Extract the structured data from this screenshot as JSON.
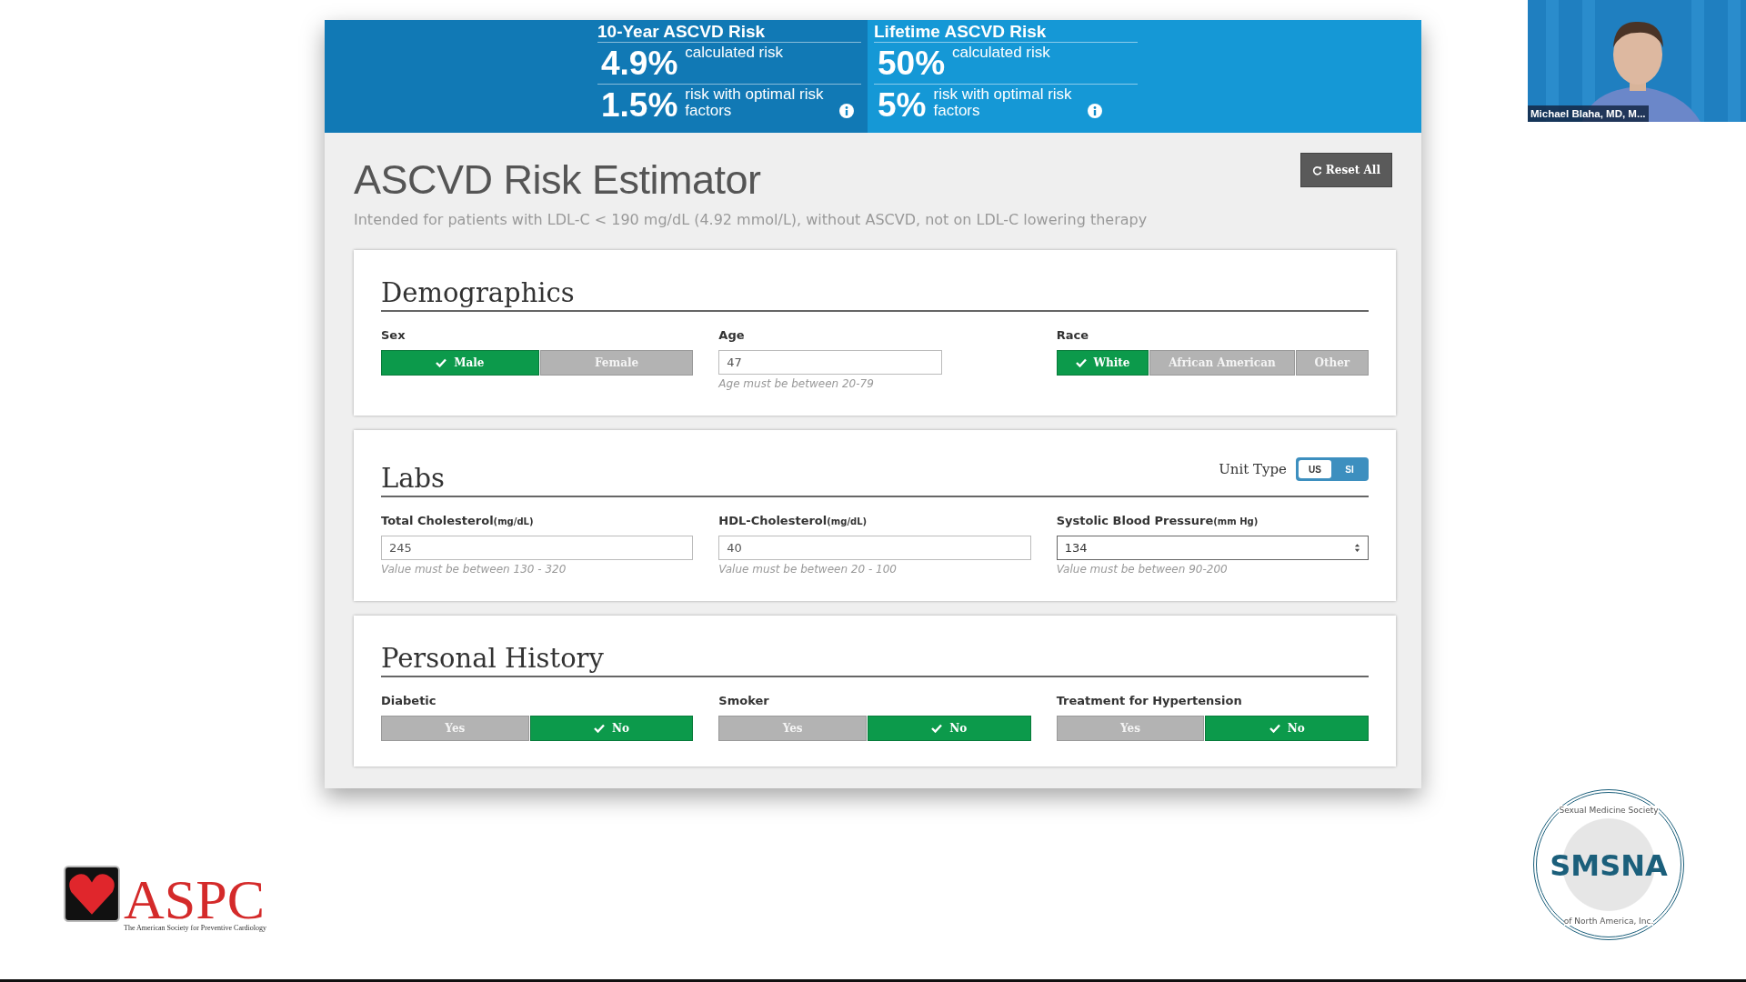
{
  "banner": [
    {
      "title": "10-Year ASCVD Risk",
      "rows": [
        {
          "value": "4.9%",
          "label": "calculated risk"
        },
        {
          "value": "1.5%",
          "label": "risk with optimal risk factors",
          "info": true
        }
      ]
    },
    {
      "title": "Lifetime ASCVD Risk",
      "rows": [
        {
          "value": "50%",
          "label": "calculated risk"
        },
        {
          "value": "5%",
          "label": "risk with optimal risk factors",
          "info": true
        }
      ]
    }
  ],
  "title": "ASCVD Risk Estimator",
  "subtitle": "Intended for patients with LDL-C < 190 mg/dL (4.92 mmol/L), without ASCVD, not on LDL-C lowering therapy",
  "reset_button": "Reset All",
  "sections": [
    {
      "title": "Demographics",
      "fields": [
        {
          "kind": "toggle",
          "label": "Sex",
          "options": [
            {
              "label": "Male",
              "selected": true
            },
            {
              "label": "Female",
              "selected": false
            }
          ]
        },
        {
          "kind": "input",
          "label": "Age",
          "value": "47",
          "hint": "Age must be between 20-79"
        },
        {
          "kind": "toggle",
          "label": "Race",
          "options": [
            {
              "label": "White",
              "selected": true
            },
            {
              "label": "African American",
              "selected": false
            },
            {
              "label": "Other",
              "selected": false
            }
          ]
        }
      ]
    },
    {
      "title": "Labs",
      "unit_type": {
        "label": "Unit Type",
        "options": [
          {
            "label": "US",
            "selected": true
          },
          {
            "label": "SI",
            "selected": false
          }
        ]
      },
      "fields": [
        {
          "kind": "input",
          "label": "Total Cholesterol",
          "unit": "(mg/dL)",
          "value": "245",
          "hint": "Value must be between 130 - 320"
        },
        {
          "kind": "input",
          "label": "HDL-Cholesterol",
          "unit": "(mg/dL)",
          "value": "40",
          "hint": "Value must be between 20 - 100"
        },
        {
          "kind": "number",
          "label": "Systolic Blood Pressure",
          "unit": "(mm Hg)",
          "value": "134",
          "hint": "Value must be between 90-200"
        }
      ]
    },
    {
      "title": "Personal History",
      "fields": [
        {
          "kind": "toggle",
          "label": "Diabetic",
          "options": [
            {
              "label": "Yes",
              "selected": false
            },
            {
              "label": "No",
              "selected": true
            }
          ]
        },
        {
          "kind": "toggle",
          "label": "Smoker",
          "options": [
            {
              "label": "Yes",
              "selected": false
            },
            {
              "label": "No",
              "selected": true
            }
          ]
        },
        {
          "kind": "toggle",
          "label": "Treatment for Hypertension",
          "options": [
            {
              "label": "Yes",
              "selected": false
            },
            {
              "label": "No",
              "selected": true
            }
          ]
        }
      ]
    }
  ],
  "video": {
    "caption": "Michael Blaha, MD, M..."
  },
  "aspc_logo": {
    "name": "ASPC",
    "tagline": "The American Society for Preventive Cardiology"
  },
  "smsna_logo": {
    "top": "Sexual Medicine Society",
    "name": "SMSNA",
    "bottom": "of North America, Inc."
  }
}
